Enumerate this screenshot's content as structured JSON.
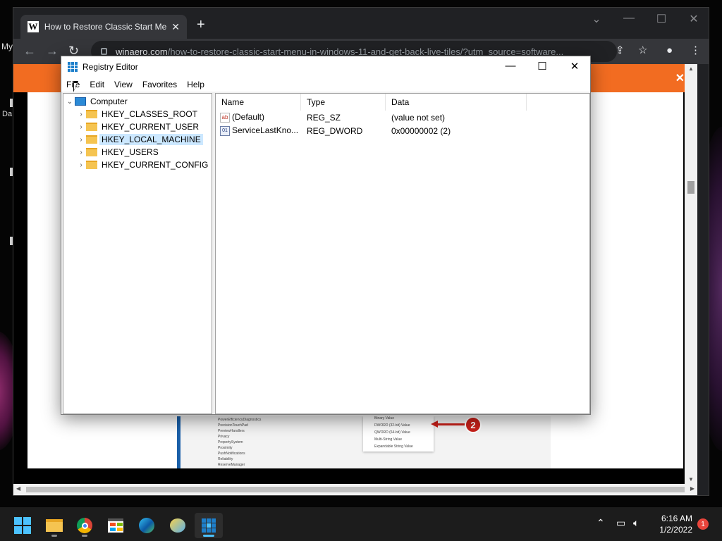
{
  "desktop": {
    "label_my": "My",
    "label_da": "Da"
  },
  "browser": {
    "tab_title": "How to Restore Classic Start Menu",
    "tab_favicon": "W",
    "tab_close": "✕",
    "new_tab": "+",
    "url_host": "winaero.com",
    "url_path": "/how-to-restore-classic-start-menu-in-windows-11-and-get-back-live-tiles/?utm_source=software...",
    "banner_close": "✕"
  },
  "article_image": {
    "tree_items": [
      "PowerEfficiencyDiagnostics",
      "PrecisionTouchPad",
      "PreviewHandlers",
      "Privacy",
      "PropertySystem",
      "Proximity",
      "PushNotifications",
      "Reliability",
      "ReserveManager"
    ],
    "menu_items": [
      "Binary Value",
      "DWORD (32-bit) Value",
      "QWORD (64-bit) Value",
      "Multi-String Value",
      "Expandable String Value"
    ],
    "badge": "2"
  },
  "regedit": {
    "title": "Registry Editor",
    "menus": [
      "File",
      "Edit",
      "View",
      "Favorites",
      "Help"
    ],
    "tree": {
      "root": "Computer",
      "keys": [
        "HKEY_CLASSES_ROOT",
        "HKEY_CURRENT_USER",
        "HKEY_LOCAL_MACHINE",
        "HKEY_USERS",
        "HKEY_CURRENT_CONFIG"
      ],
      "selected": "HKEY_LOCAL_MACHINE"
    },
    "columns": [
      "Name",
      "Type",
      "Data"
    ],
    "values": [
      {
        "name": "(Default)",
        "type": "REG_SZ",
        "data": "(value not set)",
        "icon": "string-value-icon"
      },
      {
        "name": "ServiceLastKno...",
        "type": "REG_DWORD",
        "data": "0x00000002 (2)",
        "icon": "binary-value-icon"
      }
    ]
  },
  "taskbar": {
    "time": "6:16 AM",
    "date": "1/2/2022",
    "notifications": "1",
    "apps": [
      "start-icon",
      "file-explorer-icon",
      "chrome-icon",
      "store-icon",
      "edge-icon",
      "photos-icon",
      "registry-editor-icon"
    ],
    "accent": "#4cc2ff"
  }
}
